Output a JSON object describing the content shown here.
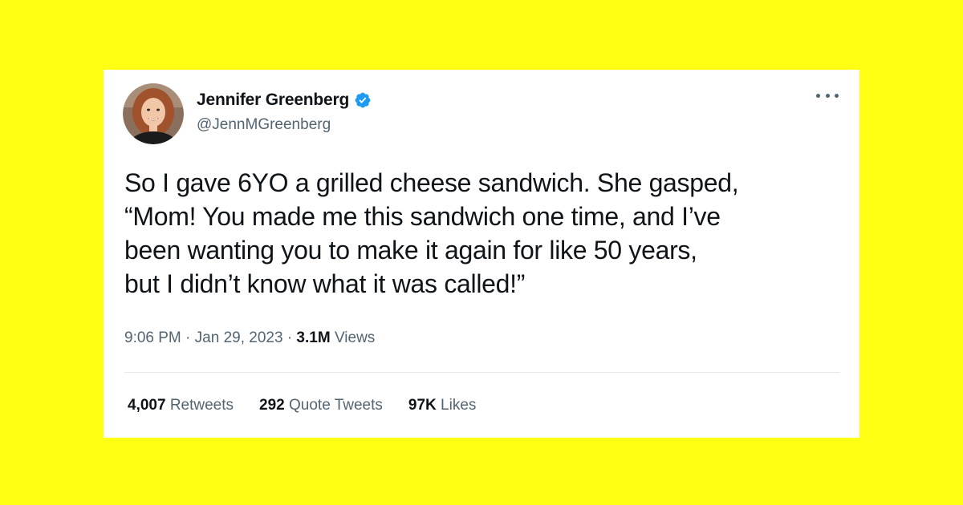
{
  "colors": {
    "background": "#FFFF14",
    "card": "#FFFFFF",
    "text_primary": "#0F1419",
    "text_secondary": "#536471",
    "verified_badge": "#1D9BF0"
  },
  "tweet": {
    "author": {
      "display_name": "Jennifer Greenberg",
      "handle": "@JennMGreenberg",
      "verified": true,
      "avatar_icon": "profile-photo"
    },
    "menu_icon": "more-horizontal-icon",
    "text": "So I gave 6YO a grilled cheese sandwich. She gasped,\n“Mom! You made me this sandwich one time, and I’ve\nbeen wanting you to make it again for like 50 years,\nbut I didn’t know what it was called!”",
    "time": "9:06 PM",
    "separator": "·",
    "date": "Jan 29, 2023",
    "views": {
      "count": "3.1M",
      "label": "Views"
    },
    "stats": {
      "retweets": {
        "count": "4,007",
        "label": "Retweets"
      },
      "quote_tweets": {
        "count": "292",
        "label": "Quote Tweets"
      },
      "likes": {
        "count": "97K",
        "label": "Likes"
      }
    }
  }
}
